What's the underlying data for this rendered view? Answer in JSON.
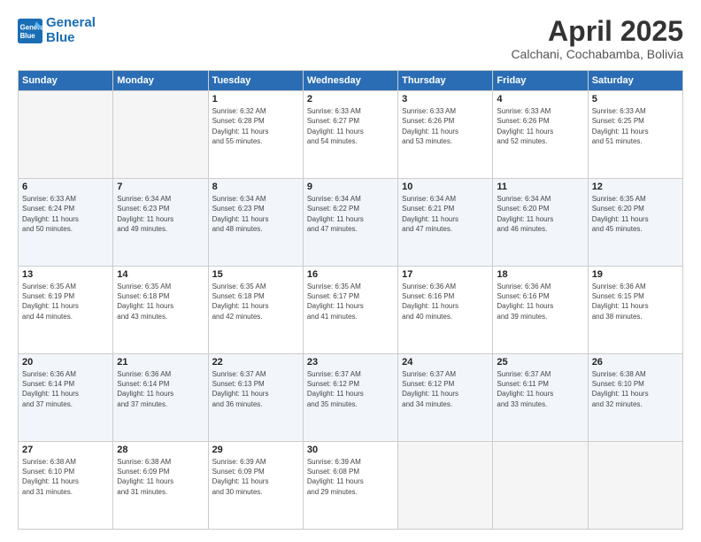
{
  "header": {
    "logo_line1": "General",
    "logo_line2": "Blue",
    "month": "April 2025",
    "location": "Calchani, Cochabamba, Bolivia"
  },
  "days_of_week": [
    "Sunday",
    "Monday",
    "Tuesday",
    "Wednesday",
    "Thursday",
    "Friday",
    "Saturday"
  ],
  "weeks": [
    [
      {
        "day": "",
        "info": ""
      },
      {
        "day": "",
        "info": ""
      },
      {
        "day": "1",
        "info": "Sunrise: 6:32 AM\nSunset: 6:28 PM\nDaylight: 11 hours\nand 55 minutes."
      },
      {
        "day": "2",
        "info": "Sunrise: 6:33 AM\nSunset: 6:27 PM\nDaylight: 11 hours\nand 54 minutes."
      },
      {
        "day": "3",
        "info": "Sunrise: 6:33 AM\nSunset: 6:26 PM\nDaylight: 11 hours\nand 53 minutes."
      },
      {
        "day": "4",
        "info": "Sunrise: 6:33 AM\nSunset: 6:26 PM\nDaylight: 11 hours\nand 52 minutes."
      },
      {
        "day": "5",
        "info": "Sunrise: 6:33 AM\nSunset: 6:25 PM\nDaylight: 11 hours\nand 51 minutes."
      }
    ],
    [
      {
        "day": "6",
        "info": "Sunrise: 6:33 AM\nSunset: 6:24 PM\nDaylight: 11 hours\nand 50 minutes."
      },
      {
        "day": "7",
        "info": "Sunrise: 6:34 AM\nSunset: 6:23 PM\nDaylight: 11 hours\nand 49 minutes."
      },
      {
        "day": "8",
        "info": "Sunrise: 6:34 AM\nSunset: 6:23 PM\nDaylight: 11 hours\nand 48 minutes."
      },
      {
        "day": "9",
        "info": "Sunrise: 6:34 AM\nSunset: 6:22 PM\nDaylight: 11 hours\nand 47 minutes."
      },
      {
        "day": "10",
        "info": "Sunrise: 6:34 AM\nSunset: 6:21 PM\nDaylight: 11 hours\nand 47 minutes."
      },
      {
        "day": "11",
        "info": "Sunrise: 6:34 AM\nSunset: 6:20 PM\nDaylight: 11 hours\nand 46 minutes."
      },
      {
        "day": "12",
        "info": "Sunrise: 6:35 AM\nSunset: 6:20 PM\nDaylight: 11 hours\nand 45 minutes."
      }
    ],
    [
      {
        "day": "13",
        "info": "Sunrise: 6:35 AM\nSunset: 6:19 PM\nDaylight: 11 hours\nand 44 minutes."
      },
      {
        "day": "14",
        "info": "Sunrise: 6:35 AM\nSunset: 6:18 PM\nDaylight: 11 hours\nand 43 minutes."
      },
      {
        "day": "15",
        "info": "Sunrise: 6:35 AM\nSunset: 6:18 PM\nDaylight: 11 hours\nand 42 minutes."
      },
      {
        "day": "16",
        "info": "Sunrise: 6:35 AM\nSunset: 6:17 PM\nDaylight: 11 hours\nand 41 minutes."
      },
      {
        "day": "17",
        "info": "Sunrise: 6:36 AM\nSunset: 6:16 PM\nDaylight: 11 hours\nand 40 minutes."
      },
      {
        "day": "18",
        "info": "Sunrise: 6:36 AM\nSunset: 6:16 PM\nDaylight: 11 hours\nand 39 minutes."
      },
      {
        "day": "19",
        "info": "Sunrise: 6:36 AM\nSunset: 6:15 PM\nDaylight: 11 hours\nand 38 minutes."
      }
    ],
    [
      {
        "day": "20",
        "info": "Sunrise: 6:36 AM\nSunset: 6:14 PM\nDaylight: 11 hours\nand 37 minutes."
      },
      {
        "day": "21",
        "info": "Sunrise: 6:36 AM\nSunset: 6:14 PM\nDaylight: 11 hours\nand 37 minutes."
      },
      {
        "day": "22",
        "info": "Sunrise: 6:37 AM\nSunset: 6:13 PM\nDaylight: 11 hours\nand 36 minutes."
      },
      {
        "day": "23",
        "info": "Sunrise: 6:37 AM\nSunset: 6:12 PM\nDaylight: 11 hours\nand 35 minutes."
      },
      {
        "day": "24",
        "info": "Sunrise: 6:37 AM\nSunset: 6:12 PM\nDaylight: 11 hours\nand 34 minutes."
      },
      {
        "day": "25",
        "info": "Sunrise: 6:37 AM\nSunset: 6:11 PM\nDaylight: 11 hours\nand 33 minutes."
      },
      {
        "day": "26",
        "info": "Sunrise: 6:38 AM\nSunset: 6:10 PM\nDaylight: 11 hours\nand 32 minutes."
      }
    ],
    [
      {
        "day": "27",
        "info": "Sunrise: 6:38 AM\nSunset: 6:10 PM\nDaylight: 11 hours\nand 31 minutes."
      },
      {
        "day": "28",
        "info": "Sunrise: 6:38 AM\nSunset: 6:09 PM\nDaylight: 11 hours\nand 31 minutes."
      },
      {
        "day": "29",
        "info": "Sunrise: 6:39 AM\nSunset: 6:09 PM\nDaylight: 11 hours\nand 30 minutes."
      },
      {
        "day": "30",
        "info": "Sunrise: 6:39 AM\nSunset: 6:08 PM\nDaylight: 11 hours\nand 29 minutes."
      },
      {
        "day": "",
        "info": ""
      },
      {
        "day": "",
        "info": ""
      },
      {
        "day": "",
        "info": ""
      }
    ]
  ]
}
